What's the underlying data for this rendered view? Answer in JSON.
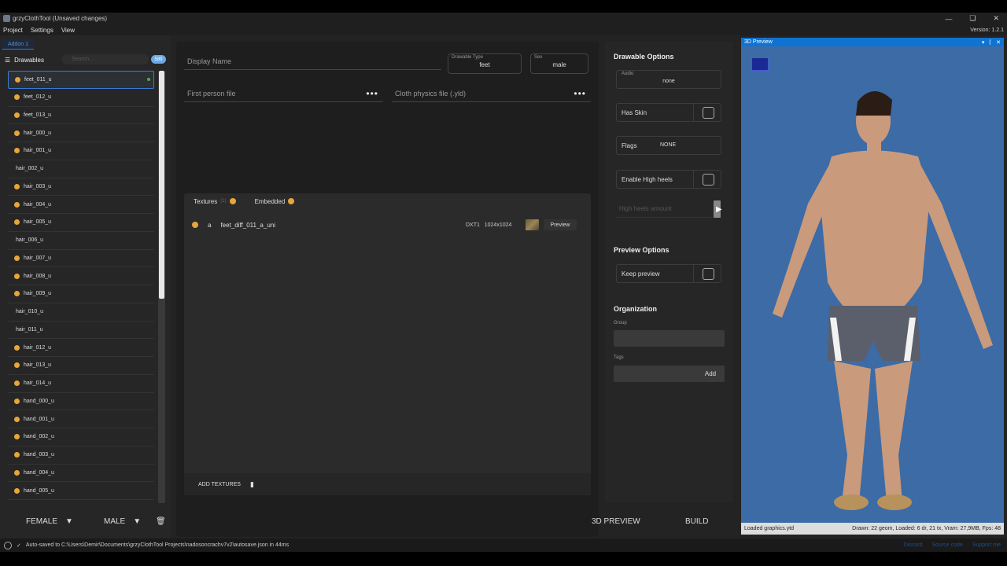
{
  "window": {
    "title": "grzyClothTool (Unsaved changes)",
    "version": "Version: 1.2.1"
  },
  "menu": [
    "Project",
    "Settings",
    "View"
  ],
  "left": {
    "addon_tab": "Addon 1",
    "drawables_label": "Drawables",
    "search_placeholder": "Search...",
    "count": "589",
    "items": [
      {
        "name": "feet_011_u",
        "warn": true,
        "selected": true
      },
      {
        "name": "feet_012_u",
        "warn": true
      },
      {
        "name": "feet_013_u",
        "warn": true
      },
      {
        "name": "hair_000_u",
        "warn": true
      },
      {
        "name": "hair_001_u",
        "warn": true
      },
      {
        "name": "hair_002_u",
        "warn": false
      },
      {
        "name": "hair_003_u",
        "warn": true
      },
      {
        "name": "hair_004_u",
        "warn": true
      },
      {
        "name": "hair_005_u",
        "warn": true
      },
      {
        "name": "hair_006_u",
        "warn": false
      },
      {
        "name": "hair_007_u",
        "warn": true
      },
      {
        "name": "hair_008_u",
        "warn": true
      },
      {
        "name": "hair_009_u",
        "warn": true
      },
      {
        "name": "hair_010_u",
        "warn": false
      },
      {
        "name": "hair_011_u",
        "warn": false
      },
      {
        "name": "hair_012_u",
        "warn": true
      },
      {
        "name": "hair_013_u",
        "warn": true
      },
      {
        "name": "hair_014_u",
        "warn": true
      },
      {
        "name": "hand_000_u",
        "warn": true
      },
      {
        "name": "hand_001_u",
        "warn": true
      },
      {
        "name": "hand_002_u",
        "warn": true
      },
      {
        "name": "hand_003_u",
        "warn": true
      },
      {
        "name": "hand_004_u",
        "warn": true
      },
      {
        "name": "hand_005_u",
        "warn": true
      }
    ],
    "female": "FEMALE",
    "male": "MALE"
  },
  "center": {
    "display_name_placeholder": "Display Name",
    "drawable_type_label": "Drawable Type",
    "drawable_type_value": "feet",
    "sex_label": "Sex",
    "sex_value": "male",
    "first_person_placeholder": "First person file",
    "cloth_physics_placeholder": "Cloth physics file (.yld)",
    "tabs": {
      "textures": "Textures",
      "textures_count": "(1)",
      "embedded": "Embedded"
    },
    "texture_row": {
      "letter": "a",
      "name": "feet_diff_011_a_uni",
      "format": "DXT1",
      "size": "1024x1024",
      "preview": "Preview"
    },
    "add_textures": "ADD TEXTURES"
  },
  "options": {
    "title": "Drawable Options",
    "audio_label": "Audio",
    "audio_value": "none",
    "has_skin": "Has Skin",
    "flags_label": "Flags",
    "flags_value": "NONE",
    "enable_high_heels": "Enable High heels",
    "high_heels_amount": "High heels amount",
    "preview_options": "Preview Options",
    "keep_preview": "Keep preview",
    "organization": "Organization",
    "group": "Group",
    "tags": "Tags",
    "add": "Add"
  },
  "buttons": {
    "preview3d": "3D PREVIEW",
    "build": "BUILD"
  },
  "preview": {
    "title": "3D Preview",
    "status_left": "Loaded graphics.ytd",
    "status_right": "Drawn: 22 geom, Loaded: 6 dr, 21 tx, Vram: 27,9MB, Fps: 48"
  },
  "status": {
    "message": "Auto-saved to C:\\Users\\Demir\\Documents\\grzyClothTool Projects\\nadosoncrachv7v2\\autosave.json in 44ms",
    "links": [
      "Discord",
      "Source code",
      "Support me"
    ]
  }
}
